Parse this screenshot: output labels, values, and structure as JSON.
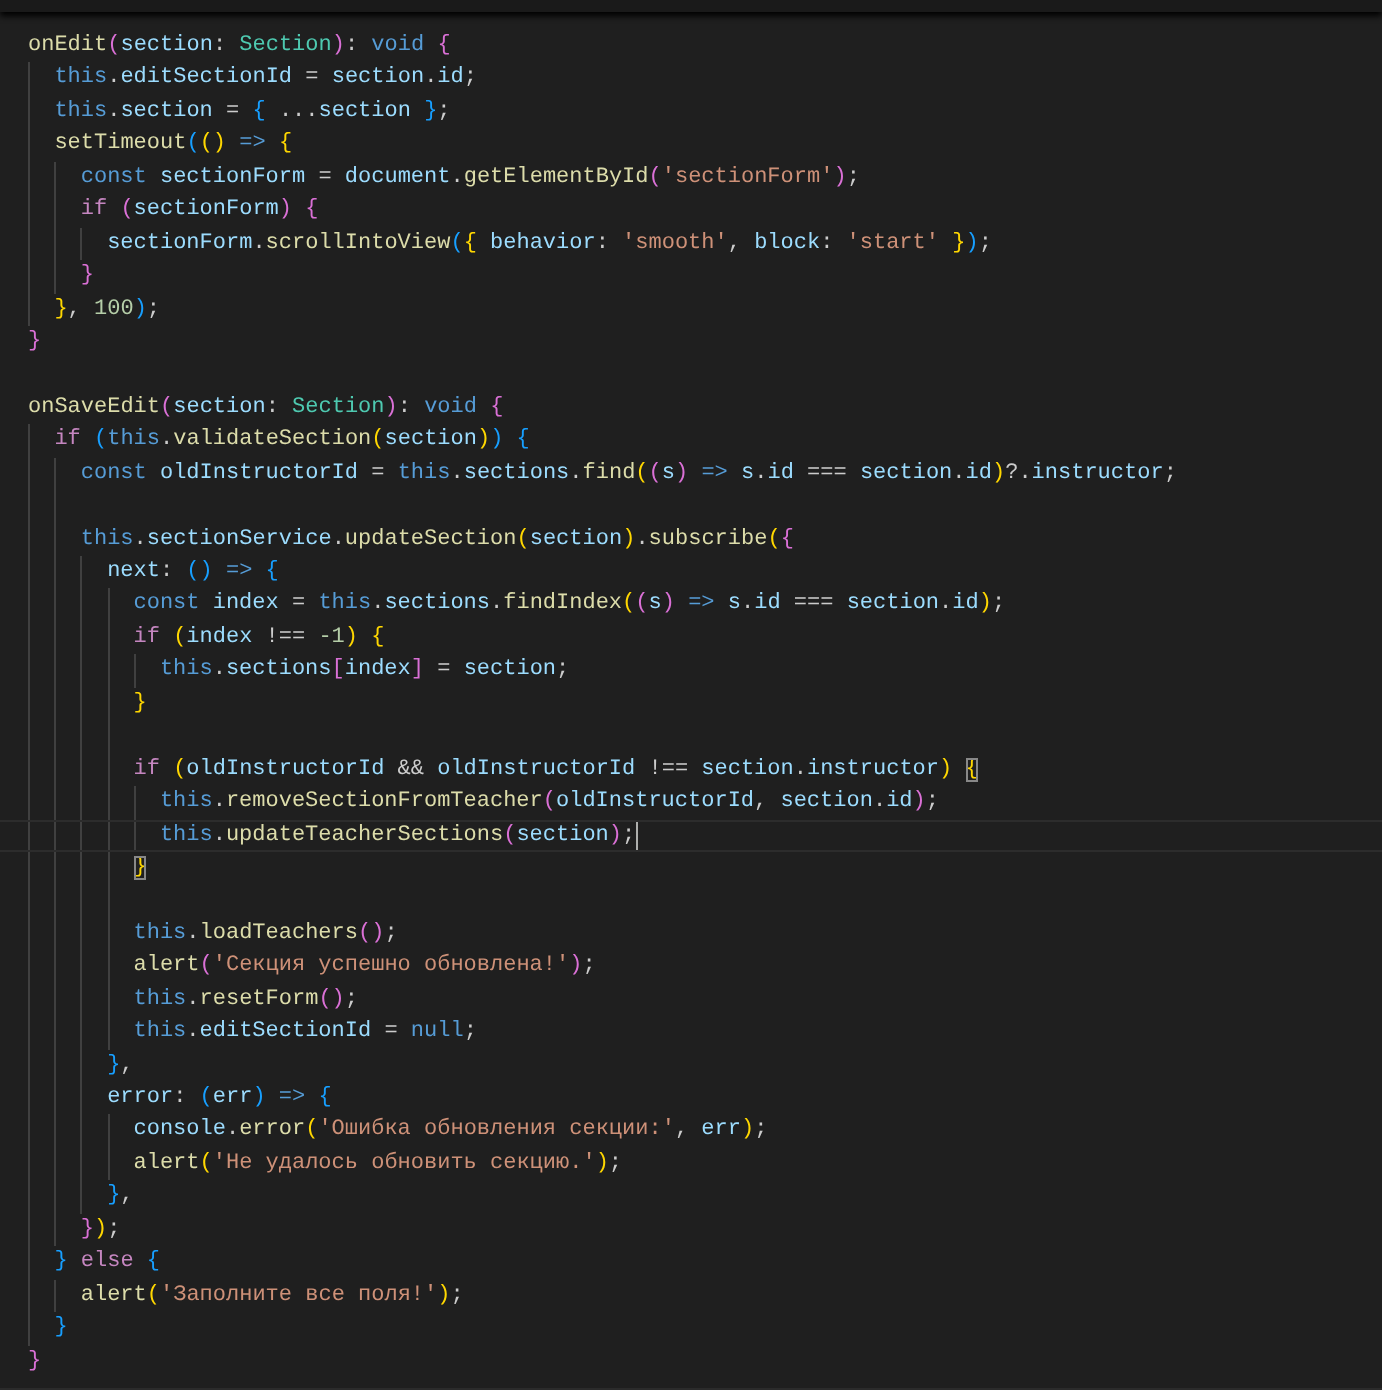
{
  "editor": {
    "lines": [
      {
        "kind": "code",
        "tokens": [
          {
            "text": "onEdit",
            "kind": "fn"
          },
          {
            "text": "(",
            "kind": "b2"
          },
          {
            "text": "section",
            "kind": "var"
          },
          {
            "text": ": ",
            "kind": "p"
          },
          {
            "text": "Section",
            "kind": "type"
          },
          {
            "text": ")",
            "kind": "b2"
          },
          {
            "text": ": ",
            "kind": "p"
          },
          {
            "text": "void ",
            "kind": "kw"
          },
          {
            "text": "{",
            "kind": "b2"
          }
        ],
        "children": [
          {
            "kind": "code",
            "tokens": [
              {
                "text": "this",
                "kind": "kw"
              },
              {
                "text": ".",
                "kind": "p"
              },
              {
                "text": "editSectionId",
                "kind": "var"
              },
              {
                "text": " = ",
                "kind": "p"
              },
              {
                "text": "section",
                "kind": "var"
              },
              {
                "text": ".",
                "kind": "p"
              },
              {
                "text": "id",
                "kind": "var"
              },
              {
                "text": ";",
                "kind": "p"
              }
            ]
          },
          {
            "kind": "code",
            "tokens": [
              {
                "text": "this",
                "kind": "kw"
              },
              {
                "text": ".",
                "kind": "p"
              },
              {
                "text": "section",
                "kind": "var"
              },
              {
                "text": " = ",
                "kind": "p"
              },
              {
                "text": "{",
                "kind": "b3"
              },
              {
                "text": " ...",
                "kind": "p"
              },
              {
                "text": "section ",
                "kind": "var"
              },
              {
                "text": "}",
                "kind": "b3"
              },
              {
                "text": ";",
                "kind": "p"
              }
            ]
          },
          {
            "kind": "code",
            "tokens": [
              {
                "text": "setTimeout",
                "kind": "fn"
              },
              {
                "text": "(",
                "kind": "b3"
              },
              {
                "text": "(",
                "kind": "b1"
              },
              {
                "text": ") ",
                "kind": "b1"
              },
              {
                "text": "=> ",
                "kind": "kw"
              },
              {
                "text": "{",
                "kind": "b1"
              }
            ],
            "children": [
              {
                "kind": "code",
                "tokens": [
                  {
                    "text": "const ",
                    "kind": "kw"
                  },
                  {
                    "text": "sectionForm",
                    "kind": "var"
                  },
                  {
                    "text": " = ",
                    "kind": "p"
                  },
                  {
                    "text": "document",
                    "kind": "var"
                  },
                  {
                    "text": ".",
                    "kind": "p"
                  },
                  {
                    "text": "getElementById",
                    "kind": "fn"
                  },
                  {
                    "text": "(",
                    "kind": "b2"
                  },
                  {
                    "text": "'sectionForm'",
                    "kind": "str"
                  },
                  {
                    "text": ")",
                    "kind": "b2"
                  },
                  {
                    "text": ";",
                    "kind": "p"
                  }
                ]
              },
              {
                "kind": "code",
                "tokens": [
                  {
                    "text": "if ",
                    "kind": "ctl"
                  },
                  {
                    "text": "(",
                    "kind": "b2"
                  },
                  {
                    "text": "sectionForm",
                    "kind": "var"
                  },
                  {
                    "text": ") ",
                    "kind": "b2"
                  },
                  {
                    "text": "{",
                    "kind": "b2"
                  }
                ],
                "children": [
                  {
                    "kind": "code",
                    "tokens": [
                      {
                        "text": "sectionForm",
                        "kind": "var"
                      },
                      {
                        "text": ".",
                        "kind": "p"
                      },
                      {
                        "text": "scrollIntoView",
                        "kind": "fn"
                      },
                      {
                        "text": "(",
                        "kind": "b3"
                      },
                      {
                        "text": "{ ",
                        "kind": "b1"
                      },
                      {
                        "text": "behavior",
                        "kind": "var"
                      },
                      {
                        "text": ": ",
                        "kind": "p"
                      },
                      {
                        "text": "'smooth'",
                        "kind": "str"
                      },
                      {
                        "text": ", ",
                        "kind": "p"
                      },
                      {
                        "text": "block",
                        "kind": "var"
                      },
                      {
                        "text": ": ",
                        "kind": "p"
                      },
                      {
                        "text": "'start' ",
                        "kind": "str"
                      },
                      {
                        "text": "}",
                        "kind": "b1"
                      },
                      {
                        "text": ")",
                        "kind": "b3"
                      },
                      {
                        "text": ";",
                        "kind": "p"
                      }
                    ]
                  }
                ]
              },
              {
                "kind": "code",
                "tokens": [
                  {
                    "text": "}",
                    "kind": "b2"
                  }
                ]
              }
            ]
          },
          {
            "kind": "code",
            "tokens": [
              {
                "text": "}",
                "kind": "b1"
              },
              {
                "text": ", ",
                "kind": "p"
              },
              {
                "text": "100",
                "kind": "num"
              },
              {
                "text": ")",
                "kind": "b3"
              },
              {
                "text": ";",
                "kind": "p"
              }
            ]
          }
        ]
      },
      {
        "kind": "code",
        "tokens": [
          {
            "text": "}",
            "kind": "b2"
          }
        ]
      },
      {
        "kind": "blank"
      },
      {
        "kind": "code",
        "tokens": [
          {
            "text": "onSaveEdit",
            "kind": "fn"
          },
          {
            "text": "(",
            "kind": "b2"
          },
          {
            "text": "section",
            "kind": "var"
          },
          {
            "text": ": ",
            "kind": "p"
          },
          {
            "text": "Section",
            "kind": "type"
          },
          {
            "text": ")",
            "kind": "b2"
          },
          {
            "text": ": ",
            "kind": "p"
          },
          {
            "text": "void ",
            "kind": "kw"
          },
          {
            "text": "{",
            "kind": "b2"
          }
        ],
        "children": [
          {
            "kind": "code",
            "tokens": [
              {
                "text": "if ",
                "kind": "ctl"
              },
              {
                "text": "(",
                "kind": "b3"
              },
              {
                "text": "this",
                "kind": "kw"
              },
              {
                "text": ".",
                "kind": "p"
              },
              {
                "text": "validateSection",
                "kind": "fn"
              },
              {
                "text": "(",
                "kind": "b1"
              },
              {
                "text": "section",
                "kind": "var"
              },
              {
                "text": ")",
                "kind": "b1"
              },
              {
                "text": ") ",
                "kind": "b3"
              },
              {
                "text": "{",
                "kind": "b3"
              }
            ],
            "children": [
              {
                "kind": "code",
                "tokens": [
                  {
                    "text": "const ",
                    "kind": "kw"
                  },
                  {
                    "text": "oldInstructorId",
                    "kind": "var"
                  },
                  {
                    "text": " = ",
                    "kind": "p"
                  },
                  {
                    "text": "this",
                    "kind": "kw"
                  },
                  {
                    "text": ".",
                    "kind": "p"
                  },
                  {
                    "text": "sections",
                    "kind": "var"
                  },
                  {
                    "text": ".",
                    "kind": "p"
                  },
                  {
                    "text": "find",
                    "kind": "fn"
                  },
                  {
                    "text": "(",
                    "kind": "b1"
                  },
                  {
                    "text": "(",
                    "kind": "b2"
                  },
                  {
                    "text": "s",
                    "kind": "var"
                  },
                  {
                    "text": ") ",
                    "kind": "b2"
                  },
                  {
                    "text": "=> ",
                    "kind": "kw"
                  },
                  {
                    "text": "s",
                    "kind": "var"
                  },
                  {
                    "text": ".",
                    "kind": "p"
                  },
                  {
                    "text": "id",
                    "kind": "var"
                  },
                  {
                    "text": " === ",
                    "kind": "p"
                  },
                  {
                    "text": "section",
                    "kind": "var"
                  },
                  {
                    "text": ".",
                    "kind": "p"
                  },
                  {
                    "text": "id",
                    "kind": "var"
                  },
                  {
                    "text": ")",
                    "kind": "b1"
                  },
                  {
                    "text": "?.",
                    "kind": "p"
                  },
                  {
                    "text": "instructor",
                    "kind": "var"
                  },
                  {
                    "text": ";",
                    "kind": "p"
                  }
                ]
              },
              {
                "kind": "blank"
              },
              {
                "kind": "code",
                "tokens": [
                  {
                    "text": "this",
                    "kind": "kw"
                  },
                  {
                    "text": ".",
                    "kind": "p"
                  },
                  {
                    "text": "sectionService",
                    "kind": "var"
                  },
                  {
                    "text": ".",
                    "kind": "p"
                  },
                  {
                    "text": "updateSection",
                    "kind": "fn"
                  },
                  {
                    "text": "(",
                    "kind": "b1"
                  },
                  {
                    "text": "section",
                    "kind": "var"
                  },
                  {
                    "text": ")",
                    "kind": "b1"
                  },
                  {
                    "text": ".",
                    "kind": "p"
                  },
                  {
                    "text": "subscribe",
                    "kind": "fn"
                  },
                  {
                    "text": "(",
                    "kind": "b1"
                  },
                  {
                    "text": "{",
                    "kind": "b2"
                  }
                ],
                "children": [
                  {
                    "kind": "code",
                    "tokens": [
                      {
                        "text": "next",
                        "kind": "var"
                      },
                      {
                        "text": ": ",
                        "kind": "p"
                      },
                      {
                        "text": "(",
                        "kind": "b3"
                      },
                      {
                        "text": ") ",
                        "kind": "b3"
                      },
                      {
                        "text": "=> ",
                        "kind": "kw"
                      },
                      {
                        "text": "{",
                        "kind": "b3"
                      }
                    ],
                    "children": [
                      {
                        "kind": "code",
                        "tokens": [
                          {
                            "text": "const ",
                            "kind": "kw"
                          },
                          {
                            "text": "index",
                            "kind": "var"
                          },
                          {
                            "text": " = ",
                            "kind": "p"
                          },
                          {
                            "text": "this",
                            "kind": "kw"
                          },
                          {
                            "text": ".",
                            "kind": "p"
                          },
                          {
                            "text": "sections",
                            "kind": "var"
                          },
                          {
                            "text": ".",
                            "kind": "p"
                          },
                          {
                            "text": "findIndex",
                            "kind": "fn"
                          },
                          {
                            "text": "(",
                            "kind": "b1"
                          },
                          {
                            "text": "(",
                            "kind": "b2"
                          },
                          {
                            "text": "s",
                            "kind": "var"
                          },
                          {
                            "text": ") ",
                            "kind": "b2"
                          },
                          {
                            "text": "=> ",
                            "kind": "kw"
                          },
                          {
                            "text": "s",
                            "kind": "var"
                          },
                          {
                            "text": ".",
                            "kind": "p"
                          },
                          {
                            "text": "id",
                            "kind": "var"
                          },
                          {
                            "text": " === ",
                            "kind": "p"
                          },
                          {
                            "text": "section",
                            "kind": "var"
                          },
                          {
                            "text": ".",
                            "kind": "p"
                          },
                          {
                            "text": "id",
                            "kind": "var"
                          },
                          {
                            "text": ")",
                            "kind": "b1"
                          },
                          {
                            "text": ";",
                            "kind": "p"
                          }
                        ]
                      },
                      {
                        "kind": "code",
                        "tokens": [
                          {
                            "text": "if ",
                            "kind": "ctl"
                          },
                          {
                            "text": "(",
                            "kind": "b1"
                          },
                          {
                            "text": "index",
                            "kind": "var"
                          },
                          {
                            "text": " !== ",
                            "kind": "p"
                          },
                          {
                            "text": "-1",
                            "kind": "num"
                          },
                          {
                            "text": ") ",
                            "kind": "b1"
                          },
                          {
                            "text": "{",
                            "kind": "b1"
                          }
                        ],
                        "children": [
                          {
                            "kind": "code",
                            "tokens": [
                              {
                                "text": "this",
                                "kind": "kw"
                              },
                              {
                                "text": ".",
                                "kind": "p"
                              },
                              {
                                "text": "sections",
                                "kind": "var"
                              },
                              {
                                "text": "[",
                                "kind": "b2"
                              },
                              {
                                "text": "index",
                                "kind": "var"
                              },
                              {
                                "text": "]",
                                "kind": "b2"
                              },
                              {
                                "text": " = ",
                                "kind": "p"
                              },
                              {
                                "text": "section",
                                "kind": "var"
                              },
                              {
                                "text": ";",
                                "kind": "p"
                              }
                            ]
                          }
                        ]
                      },
                      {
                        "kind": "code",
                        "tokens": [
                          {
                            "text": "}",
                            "kind": "b1"
                          }
                        ]
                      },
                      {
                        "kind": "blank"
                      },
                      {
                        "kind": "code",
                        "tokens": [
                          {
                            "text": "if ",
                            "kind": "ctl"
                          },
                          {
                            "text": "(",
                            "kind": "b1"
                          },
                          {
                            "text": "oldInstructorId",
                            "kind": "var"
                          },
                          {
                            "text": " && ",
                            "kind": "p"
                          },
                          {
                            "text": "oldInstructorId",
                            "kind": "var"
                          },
                          {
                            "text": " !== ",
                            "kind": "p"
                          },
                          {
                            "text": "section",
                            "kind": "var"
                          },
                          {
                            "text": ".",
                            "kind": "p"
                          },
                          {
                            "text": "instructor",
                            "kind": "var"
                          },
                          {
                            "text": ") ",
                            "kind": "b1"
                          },
                          {
                            "text": "{",
                            "kind": "bm"
                          }
                        ],
                        "children": [
                          {
                            "kind": "code",
                            "tokens": [
                              {
                                "text": "this",
                                "kind": "kw"
                              },
                              {
                                "text": ".",
                                "kind": "p"
                              },
                              {
                                "text": "removeSectionFromTeacher",
                                "kind": "fn"
                              },
                              {
                                "text": "(",
                                "kind": "b2"
                              },
                              {
                                "text": "oldInstructorId",
                                "kind": "var"
                              },
                              {
                                "text": ", ",
                                "kind": "p"
                              },
                              {
                                "text": "section",
                                "kind": "var"
                              },
                              {
                                "text": ".",
                                "kind": "p"
                              },
                              {
                                "text": "id",
                                "kind": "var"
                              },
                              {
                                "text": ")",
                                "kind": "b2"
                              },
                              {
                                "text": ";",
                                "kind": "p"
                              }
                            ]
                          },
                          {
                            "kind": "code",
                            "current": true,
                            "tokens": [
                              {
                                "text": "this",
                                "kind": "kw"
                              },
                              {
                                "text": ".",
                                "kind": "p"
                              },
                              {
                                "text": "updateTeacherSections",
                                "kind": "fn"
                              },
                              {
                                "text": "(",
                                "kind": "b2"
                              },
                              {
                                "text": "section",
                                "kind": "var"
                              },
                              {
                                "text": ")",
                                "kind": "b2"
                              },
                              {
                                "text": ";",
                                "kind": "p"
                              }
                            ]
                          }
                        ]
                      },
                      {
                        "kind": "code",
                        "tokens": [
                          {
                            "text": "}",
                            "kind": "bm"
                          }
                        ]
                      },
                      {
                        "kind": "blank"
                      },
                      {
                        "kind": "code",
                        "tokens": [
                          {
                            "text": "this",
                            "kind": "kw"
                          },
                          {
                            "text": ".",
                            "kind": "p"
                          },
                          {
                            "text": "loadTeachers",
                            "kind": "fn"
                          },
                          {
                            "text": "(",
                            "kind": "b2"
                          },
                          {
                            "text": ")",
                            "kind": "b2"
                          },
                          {
                            "text": ";",
                            "kind": "p"
                          }
                        ]
                      },
                      {
                        "kind": "code",
                        "tokens": [
                          {
                            "text": "alert",
                            "kind": "fn"
                          },
                          {
                            "text": "(",
                            "kind": "b2"
                          },
                          {
                            "text": "'Секция успешно обновлена!'",
                            "kind": "str"
                          },
                          {
                            "text": ")",
                            "kind": "b2"
                          },
                          {
                            "text": ";",
                            "kind": "p"
                          }
                        ]
                      },
                      {
                        "kind": "code",
                        "tokens": [
                          {
                            "text": "this",
                            "kind": "kw"
                          },
                          {
                            "text": ".",
                            "kind": "p"
                          },
                          {
                            "text": "resetForm",
                            "kind": "fn"
                          },
                          {
                            "text": "(",
                            "kind": "b2"
                          },
                          {
                            "text": ")",
                            "kind": "b2"
                          },
                          {
                            "text": ";",
                            "kind": "p"
                          }
                        ]
                      },
                      {
                        "kind": "code",
                        "tokens": [
                          {
                            "text": "this",
                            "kind": "kw"
                          },
                          {
                            "text": ".",
                            "kind": "p"
                          },
                          {
                            "text": "editSectionId",
                            "kind": "var"
                          },
                          {
                            "text": " = ",
                            "kind": "p"
                          },
                          {
                            "text": "null",
                            "kind": "kw"
                          },
                          {
                            "text": ";",
                            "kind": "p"
                          }
                        ]
                      }
                    ]
                  },
                  {
                    "kind": "code",
                    "tokens": [
                      {
                        "text": "}",
                        "kind": "b3"
                      },
                      {
                        "text": ",",
                        "kind": "p"
                      }
                    ]
                  },
                  {
                    "kind": "code",
                    "tokens": [
                      {
                        "text": "error",
                        "kind": "var"
                      },
                      {
                        "text": ": ",
                        "kind": "p"
                      },
                      {
                        "text": "(",
                        "kind": "b3"
                      },
                      {
                        "text": "err",
                        "kind": "var"
                      },
                      {
                        "text": ") ",
                        "kind": "b3"
                      },
                      {
                        "text": "=> ",
                        "kind": "kw"
                      },
                      {
                        "text": "{",
                        "kind": "b3"
                      }
                    ],
                    "children": [
                      {
                        "kind": "code",
                        "tokens": [
                          {
                            "text": "console",
                            "kind": "var"
                          },
                          {
                            "text": ".",
                            "kind": "p"
                          },
                          {
                            "text": "error",
                            "kind": "fn"
                          },
                          {
                            "text": "(",
                            "kind": "b1"
                          },
                          {
                            "text": "'Ошибка обновления секции:'",
                            "kind": "str"
                          },
                          {
                            "text": ", ",
                            "kind": "p"
                          },
                          {
                            "text": "err",
                            "kind": "var"
                          },
                          {
                            "text": ")",
                            "kind": "b1"
                          },
                          {
                            "text": ";",
                            "kind": "p"
                          }
                        ]
                      },
                      {
                        "kind": "code",
                        "tokens": [
                          {
                            "text": "alert",
                            "kind": "fn"
                          },
                          {
                            "text": "(",
                            "kind": "b1"
                          },
                          {
                            "text": "'Не удалось обновить секцию.'",
                            "kind": "str"
                          },
                          {
                            "text": ")",
                            "kind": "b1"
                          },
                          {
                            "text": ";",
                            "kind": "p"
                          }
                        ]
                      }
                    ]
                  },
                  {
                    "kind": "code",
                    "tokens": [
                      {
                        "text": "}",
                        "kind": "b3"
                      },
                      {
                        "text": ",",
                        "kind": "p"
                      }
                    ]
                  }
                ]
              },
              {
                "kind": "code",
                "tokens": [
                  {
                    "text": "}",
                    "kind": "b2"
                  },
                  {
                    "text": ")",
                    "kind": "b1"
                  },
                  {
                    "text": ";",
                    "kind": "p"
                  }
                ]
              }
            ]
          },
          {
            "kind": "code",
            "tokens": [
              {
                "text": "} ",
                "kind": "b3"
              },
              {
                "text": "else ",
                "kind": "ctl"
              },
              {
                "text": "{",
                "kind": "b3"
              }
            ],
            "children": [
              {
                "kind": "code",
                "tokens": [
                  {
                    "text": "alert",
                    "kind": "fn"
                  },
                  {
                    "text": "(",
                    "kind": "b1"
                  },
                  {
                    "text": "'Заполните все поля!'",
                    "kind": "str"
                  },
                  {
                    "text": ")",
                    "kind": "b1"
                  },
                  {
                    "text": ";",
                    "kind": "p"
                  }
                ]
              }
            ]
          },
          {
            "kind": "code",
            "tokens": [
              {
                "text": "}",
                "kind": "b3"
              }
            ]
          }
        ]
      },
      {
        "kind": "code",
        "tokens": [
          {
            "text": "}",
            "kind": "b2"
          }
        ]
      }
    ]
  }
}
